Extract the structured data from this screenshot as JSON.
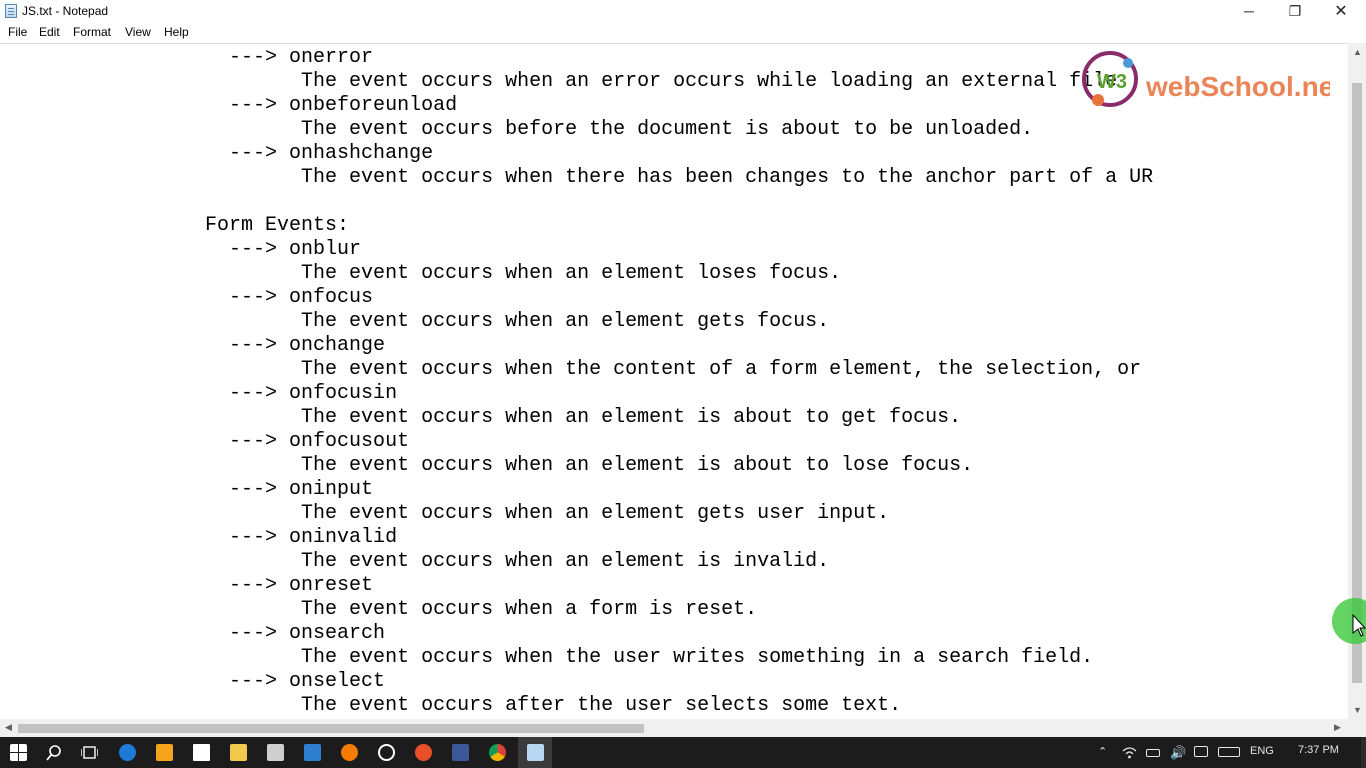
{
  "window": {
    "title": "JS.txt - Notepad",
    "minimize_glyph": "─",
    "restore_glyph": "❐",
    "close_glyph": "✕"
  },
  "menu": [
    "File",
    "Edit",
    "Format",
    "View",
    "Help"
  ],
  "editor_lines": [
    "                   ---> onerror",
    "                         The event occurs when an error occurs while loading an external file",
    "                   ---> onbeforeunload",
    "                         The event occurs before the document is about to be unloaded.",
    "                   ---> onhashchange",
    "                         The event occurs when there has been changes to the anchor part of a UR",
    "",
    "                 Form Events:",
    "                   ---> onblur",
    "                         The event occurs when an element loses focus.",
    "                   ---> onfocus",
    "                         The event occurs when an element gets focus.",
    "                   ---> onchange",
    "                         The event occurs when the content of a form element, the selection, or",
    "                   ---> onfocusin",
    "                         The event occurs when an element is about to get focus.",
    "                   ---> onfocusout",
    "                         The event occurs when an element is about to lose focus.",
    "                   ---> oninput",
    "                         The event occurs when an element gets user input.",
    "                   ---> oninvalid",
    "                         The event occurs when an element is invalid.",
    "                   ---> onreset",
    "                         The event occurs when a form is reset.",
    "                   ---> onsearch",
    "                         The event occurs when the user writes something in a search field.",
    "                   ---> onselect",
    "                         The event occurs after the user selects some text."
  ],
  "watermark": {
    "brand": "webSchool.net",
    "brand_color": "#e8703a",
    "logo_color": "#8a2b6a"
  },
  "scrollbars": {
    "up": "▲",
    "down": "▼",
    "left": "◀",
    "right": "▶"
  },
  "taskbar": {
    "icons": [
      "windows-start-icon",
      "search-icon",
      "task-view-icon",
      "edge-icon",
      "media-icon",
      "store-icon",
      "file-explorer-icon",
      "calculator-icon",
      "app-icon",
      "paint-icon",
      "chrome-alt-icon",
      "firefox-icon",
      "facebook-icon",
      "chrome-icon",
      "notepad-icon"
    ],
    "language": "ENG",
    "clock": "7:37 PM"
  },
  "colors": {
    "taskbar": "#1c1c1c",
    "cursor_highlight": "#3cc83c"
  }
}
